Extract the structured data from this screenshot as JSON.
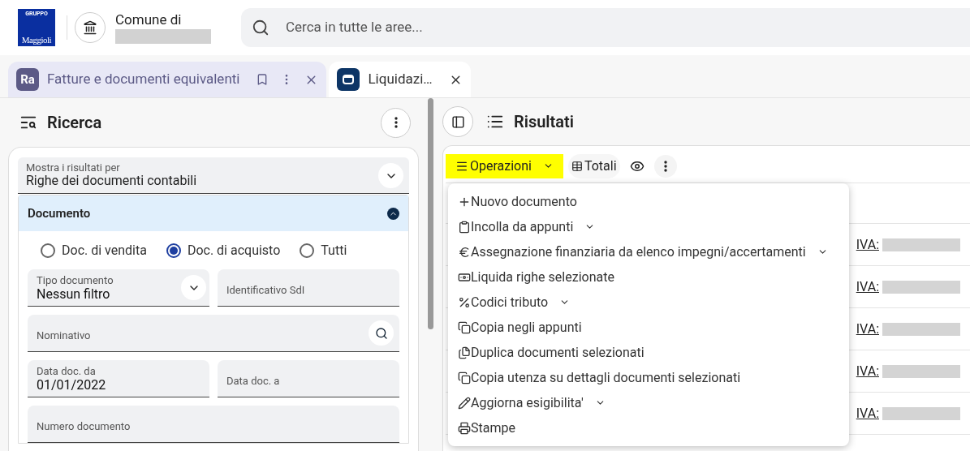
{
  "header": {
    "logo": {
      "top": "GRUPPO",
      "name": "Maggioli"
    },
    "org_label": "Comune di",
    "search": {
      "placeholder": "Cerca in tutte le aree..."
    }
  },
  "tabs": [
    {
      "label": "Fatture e documenti equivalenti",
      "selected": true,
      "logo": "Ra"
    },
    {
      "label": "Liquidazi…",
      "selected": false
    }
  ],
  "search_panel": {
    "title": "Ricerca",
    "results_by": {
      "label": "Mostra i risultati per",
      "value": "Righe dei documenti contabili"
    },
    "section": {
      "title": "Documento",
      "expanded": true,
      "radios": [
        {
          "label": "Doc. di vendita",
          "selected": false
        },
        {
          "label": "Doc. di acquisto",
          "selected": true
        },
        {
          "label": "Tutti",
          "selected": false
        }
      ],
      "fields": [
        {
          "kind": "select",
          "label": "Tipo documento",
          "value": "Nessun filtro"
        },
        {
          "kind": "text",
          "placeholder": "Identificativo SdI"
        },
        {
          "kind": "search",
          "placeholder": "Nominativo"
        },
        {
          "kind": "text",
          "label": "Data doc. da",
          "value": "01/01/2022"
        },
        {
          "kind": "text",
          "placeholder": "Data doc. a"
        },
        {
          "kind": "wide",
          "placeholder": "Numero documento"
        }
      ]
    }
  },
  "results_panel": {
    "title": "Risultati",
    "toolbar": {
      "operations": "Operazioni",
      "totals": "Totali"
    },
    "menu": [
      {
        "label": "Nuovo documento",
        "has_submenu": false
      },
      {
        "label": "Incolla da appunti",
        "has_submenu": true
      },
      {
        "label": "Assegnazione finanziaria da elenco impegni/accertamenti",
        "has_submenu": true
      },
      {
        "label": "Liquida righe selezionate",
        "has_submenu": false
      },
      {
        "label": "Codici tributo",
        "has_submenu": true
      },
      {
        "label": "Copia negli appunti",
        "has_submenu": false
      },
      {
        "label": "Duplica documenti selezionati",
        "has_submenu": false
      },
      {
        "label": "Copia utenza su dettagli documenti selezionati",
        "has_submenu": false
      },
      {
        "label": "Aggiorna esigibilita'",
        "has_submenu": true
      },
      {
        "label": "Stampe",
        "has_submenu": false
      }
    ],
    "rows": [
      {
        "vat_label": "IVA:"
      },
      {
        "vat_label": "IVA:"
      },
      {
        "vat_label": "IVA:"
      },
      {
        "vat_label": "IVA:"
      },
      {
        "vat_label": "IVA:"
      }
    ]
  }
}
